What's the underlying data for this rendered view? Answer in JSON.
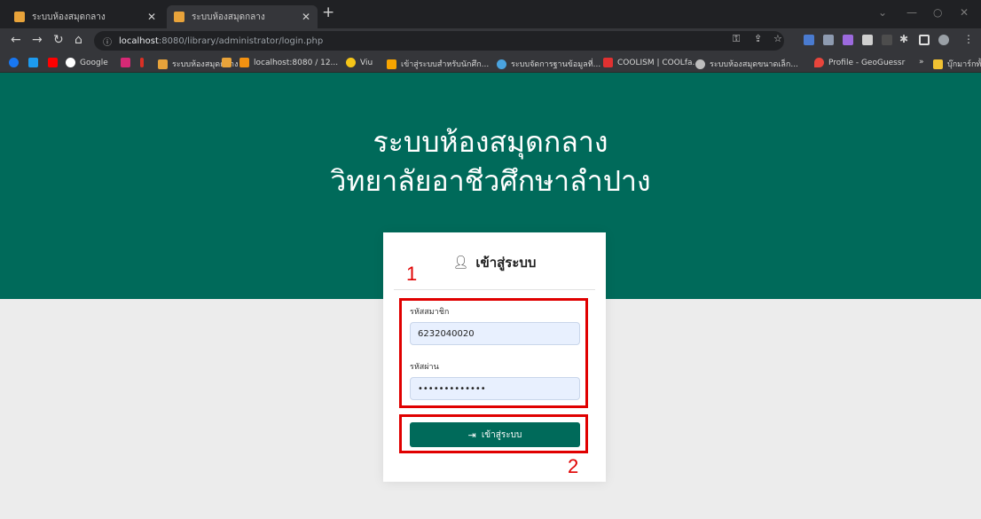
{
  "browser": {
    "tabs": [
      {
        "title": "ระบบห้องสมุดกลาง",
        "active": false
      },
      {
        "title": "ระบบห้องสมุดกลาง",
        "active": true
      }
    ],
    "url_prefix": "localhost",
    "url_rest": ":8080/library/administrator/login.php",
    "bookmarks": [
      {
        "label": "",
        "icon": "facebook-icon",
        "color": "#1877f2"
      },
      {
        "label": "",
        "icon": "twitter-icon",
        "color": "#1d9bf0"
      },
      {
        "label": "",
        "icon": "youtube-icon",
        "color": "#ff0000"
      },
      {
        "label": "Google",
        "icon": "google-icon",
        "color": "#ffffff"
      },
      {
        "label": "",
        "icon": "instagram-icon",
        "color": "#d62976"
      },
      {
        "label": "",
        "icon": "bookmark-icon",
        "color": "#d93025"
      },
      {
        "label": "ระบบห้องสมุดกลาง",
        "icon": "site-icon",
        "color": "#e8a33a"
      },
      {
        "label": "",
        "icon": "site-icon",
        "color": "#e8a33a"
      },
      {
        "label": "localhost:8080 / 12...",
        "icon": "phpmyadmin-icon",
        "color": "#f29111"
      },
      {
        "label": "Viu",
        "icon": "viu-icon",
        "color": "#f5c518"
      },
      {
        "label": "เข้าสู่ระบบสำหรับนักศึก...",
        "icon": "site-icon",
        "color": "#f7a400"
      },
      {
        "label": "ระบบจัดการฐานข้อมูลที่...",
        "icon": "site-icon",
        "color": "#4aa3df"
      },
      {
        "label": "COOLISM | COOLfa...",
        "icon": "site-icon",
        "color": "#e03131"
      },
      {
        "label": "ระบบห้องสมุดขนาดเล็ก...",
        "icon": "globe-icon",
        "color": "#bdbdbd"
      },
      {
        "label": "Profile - GeoGuessr",
        "icon": "pin-icon",
        "color": "#e8453c"
      },
      {
        "label": "บุ๊กมาร์กทั้งหมด",
        "icon": "folder-icon",
        "color": "#f1c232"
      }
    ]
  },
  "hero": {
    "title": "ระบบห้องสมุดกลาง",
    "subtitle": "วิทยาลัยอาชีวศึกษาลำปาง",
    "color": "#006a5a"
  },
  "login": {
    "heading": "เข้าสู่ระบบ",
    "member_label": "รหัสสมาชิก",
    "member_value": "6232040020",
    "password_label": "รหัสผ่าน",
    "password_value": "•••••••••••••",
    "button_label": "เข้าสู่ระบบ"
  },
  "annotations": {
    "label_1": "1",
    "label_2": "2",
    "color": "#e00000"
  }
}
